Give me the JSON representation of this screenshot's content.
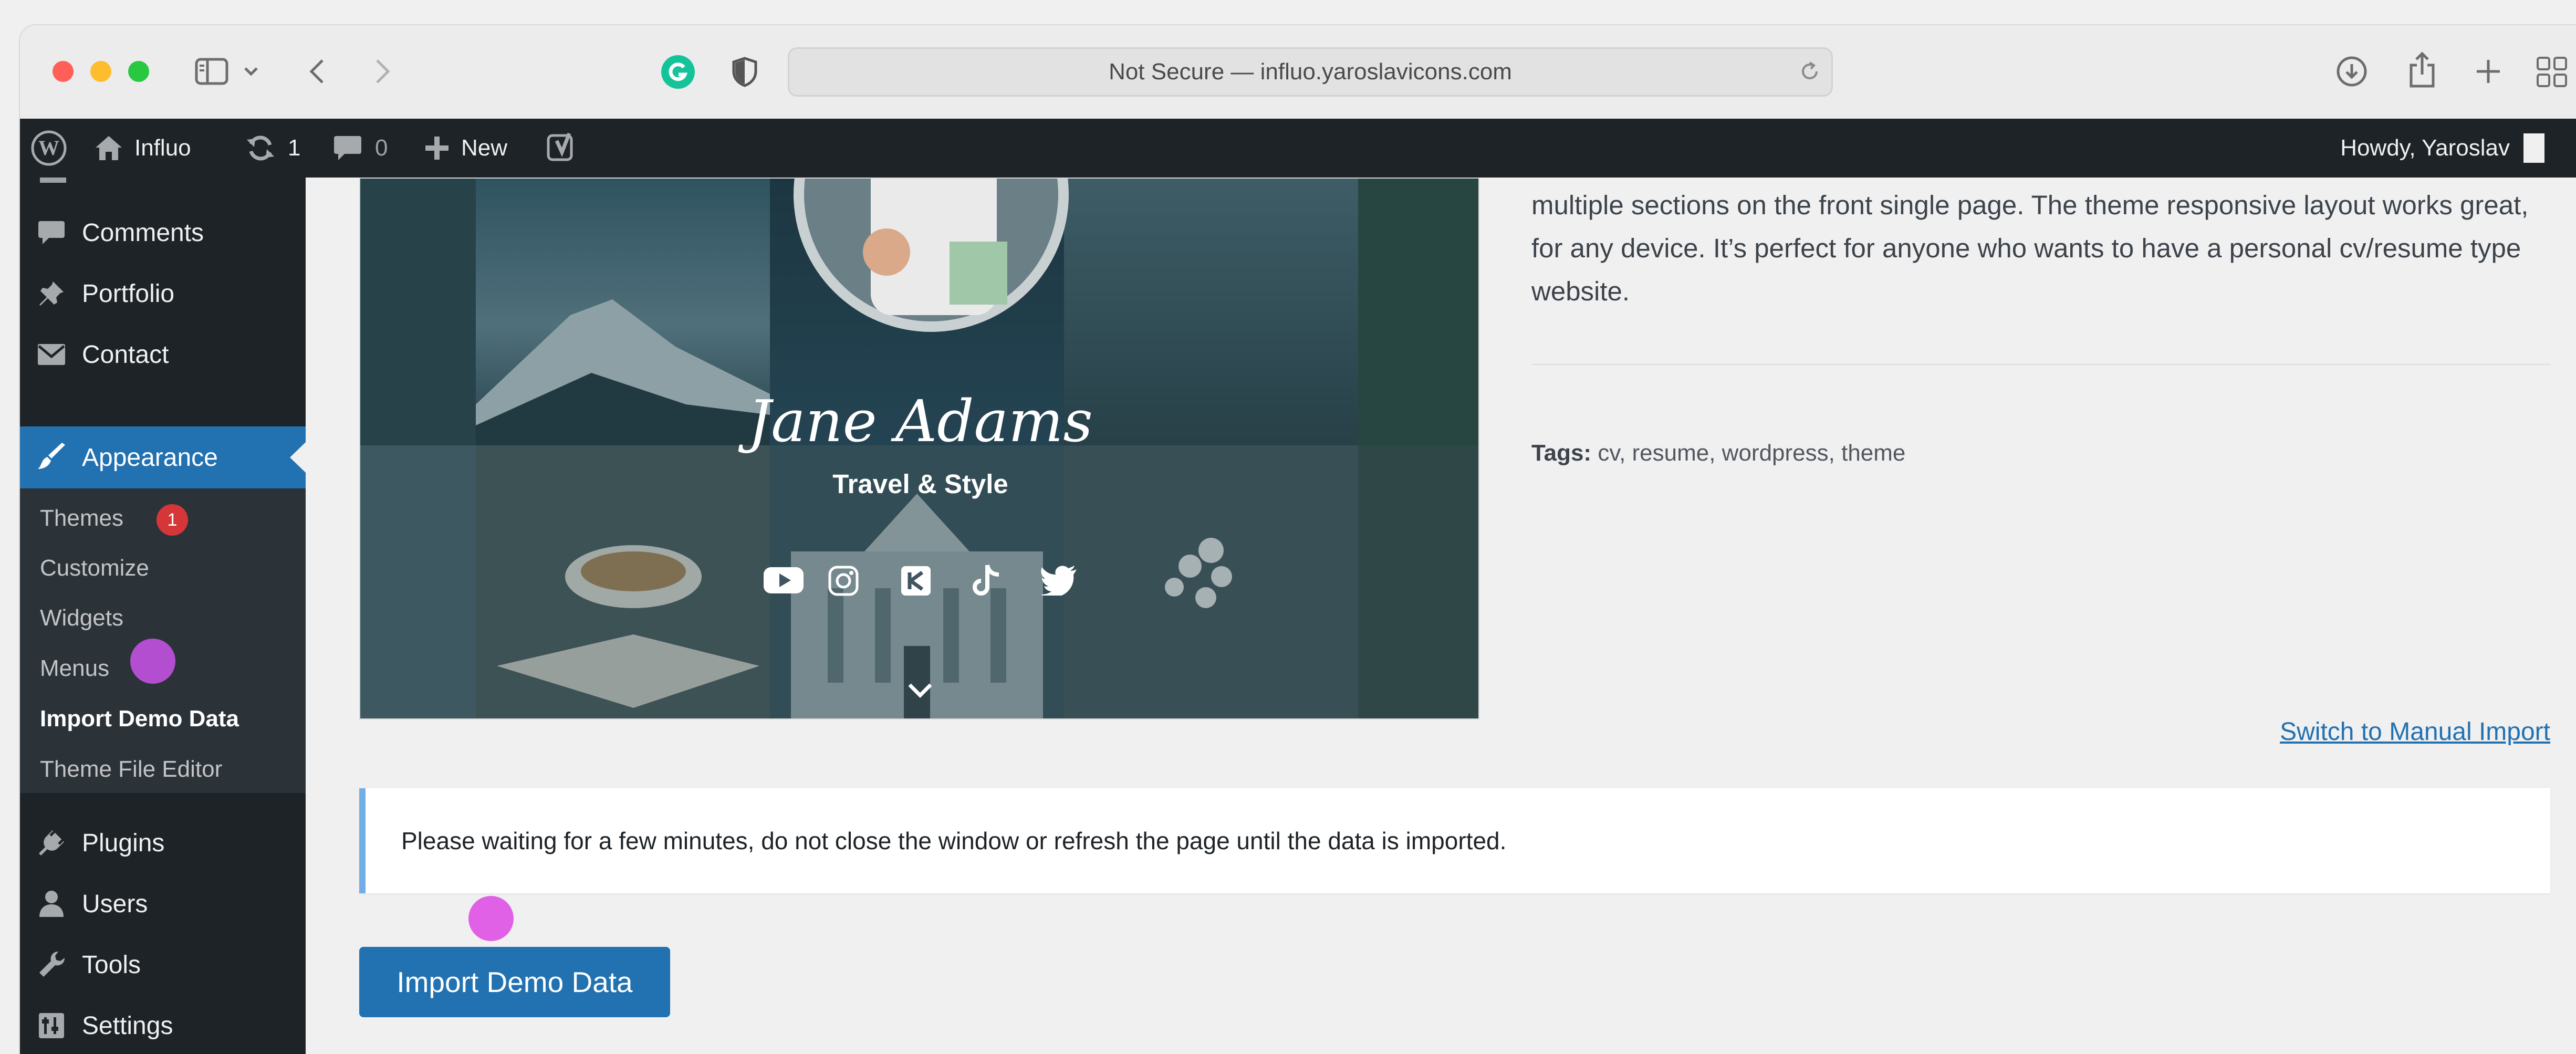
{
  "browser": {
    "url_text": "Not Secure — influo.yaroslavicons.com"
  },
  "adminbar": {
    "site_name": "Influo",
    "updates_count": "1",
    "comments_count": "0",
    "new_label": "New",
    "howdy": "Howdy, Yaroslav"
  },
  "sidebar": {
    "items_top": [
      {
        "label": "Comments",
        "icon": "comment-icon"
      },
      {
        "label": "Portfolio",
        "icon": "pin-icon"
      },
      {
        "label": "Contact",
        "icon": "mail-icon"
      }
    ],
    "appearance": "Appearance",
    "submenu": [
      {
        "label": "Themes"
      },
      {
        "label": "Customize"
      },
      {
        "label": "Widgets"
      },
      {
        "label": "Menus"
      },
      {
        "label": "Import Demo Data"
      },
      {
        "label": "Theme File Editor"
      }
    ],
    "themes_badge": "1",
    "items_bottom": [
      {
        "label": "Plugins",
        "icon": "plugin-icon"
      },
      {
        "label": "Users",
        "icon": "user-icon"
      },
      {
        "label": "Tools",
        "icon": "wrench-icon"
      },
      {
        "label": "Settings",
        "icon": "settings-icon"
      }
    ]
  },
  "preview": {
    "signature": "Jane Adams",
    "tagline": "Travel & Style"
  },
  "main": {
    "description": "multiple sections on the front single page. The theme responsive layout works great, for any device. It’s perfect for anyone who wants to have a personal cv/resume type website.",
    "tags_label": "Tags:",
    "tags_value": "cv, resume, wordpress, theme",
    "manual_import": "Switch to Manual Import",
    "notice": "Please waiting for a few minutes, do not close the window or refresh the page until the data is imported.",
    "import_button": "Import Demo Data"
  },
  "colors": {
    "admin_dark": "#1d2327",
    "accent_blue": "#2271b1",
    "badge_red": "#d63638",
    "notice_border": "#72aee6"
  }
}
